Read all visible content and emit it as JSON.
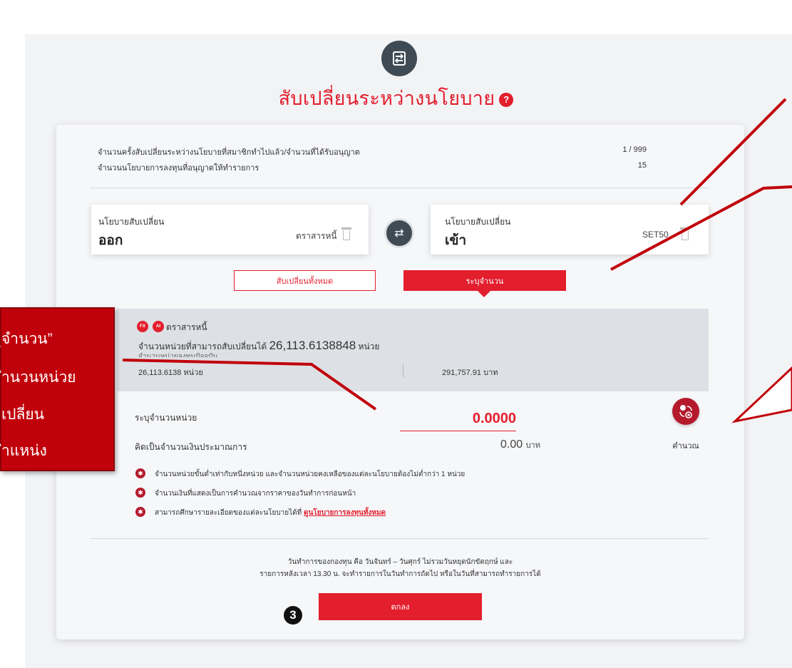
{
  "page": {
    "title": "สับเปลี่ยนระหว่างนโยบาย",
    "help_icon": "?",
    "header_icon": "exchange-icon"
  },
  "info": {
    "switch_count_label": "จำนวนครั้งสับเปลี่ยนระหว่างนโยบายที่สมาชิกทำไปแล้ว/จำนวนที่ได้รับอนุญาต",
    "switch_count_value": "1 / 999",
    "allowed_policies_label": "จำนวนนโยบายการลงทุนที่อนุญาตให้ทำรายการ",
    "allowed_policies_value": "15"
  },
  "switch_out": {
    "label": "นโยบายสับเปลี่ยน",
    "direction": "ออก",
    "fund": "ตราสารหนี้"
  },
  "switch_in": {
    "label": "นโยบายสับเปลี่ยน",
    "direction": "เข้า",
    "fund": "SET50"
  },
  "tabs": {
    "all": "สับเปลี่ยนทั้งหมด",
    "specify": "ระบุจำนวน"
  },
  "fund_info": {
    "badge_fx": "FX",
    "badge_ai": "AI",
    "name": "ตราสารหนี้",
    "available_prefix": "จำนวนหน่วยที่สามารถสับเปลี่ยนได้",
    "available_units": "26,113.6138848",
    "available_suffix": "หน่วย",
    "holding_label": "จำนวนหน่วยลงทุนปัจจุบัน",
    "holding_units": "26,113.6138 หน่วย",
    "holding_amount": "291,757.91 บาท"
  },
  "form": {
    "units_label": "ระบุจำนวนหน่วย",
    "units_value": "0.0000",
    "estimate_label": "คิดเป็นจำนวนเงินประมาณการ",
    "estimate_value": "0.00",
    "estimate_unit": "บาท",
    "calc_label": "คำนวณ"
  },
  "notes": {
    "n1": "จำนวนหน่วยขั้นต่ำเท่ากับหนึ่งหน่วย และจำนวนหน่วยคงเหลือของแต่ละนโยบายต้องไม่ต่ำกว่า 1 หน่วย",
    "n2": "จำนวนเงินที่แสดงเป็นการคำนวณจากราคาของวันทำการก่อนหน้า",
    "n3_prefix": "สามารถศึกษารายละเอียดของแต่ละนโยบายได้ที่",
    "n3_link": "ดูนโยบายการลงทุนทั้งหมด"
  },
  "footer": {
    "line1": "วันทำการของกองทุน คือ วันจันทร์ – วันศุกร์ ไม่รวมวันหยุดนักขัตฤกษ์ และ",
    "line2": "รายการหลังเวลา 13.30 น. จะทำรายการในวันทำการถัดไป หรือในวันที่สามารถทำรายการได้",
    "ok": "ตกลง"
  },
  "step_number": "3",
  "callout": {
    "line1": "ุจำนวน”",
    "line2": "ำนวนหน่วย",
    "line3": "เปลี่ยน",
    "line4": "ำแหน่ง"
  },
  "colors": {
    "accent": "#e31e2d",
    "dark_icon": "#3e4b55",
    "callout": "#c0000b"
  }
}
